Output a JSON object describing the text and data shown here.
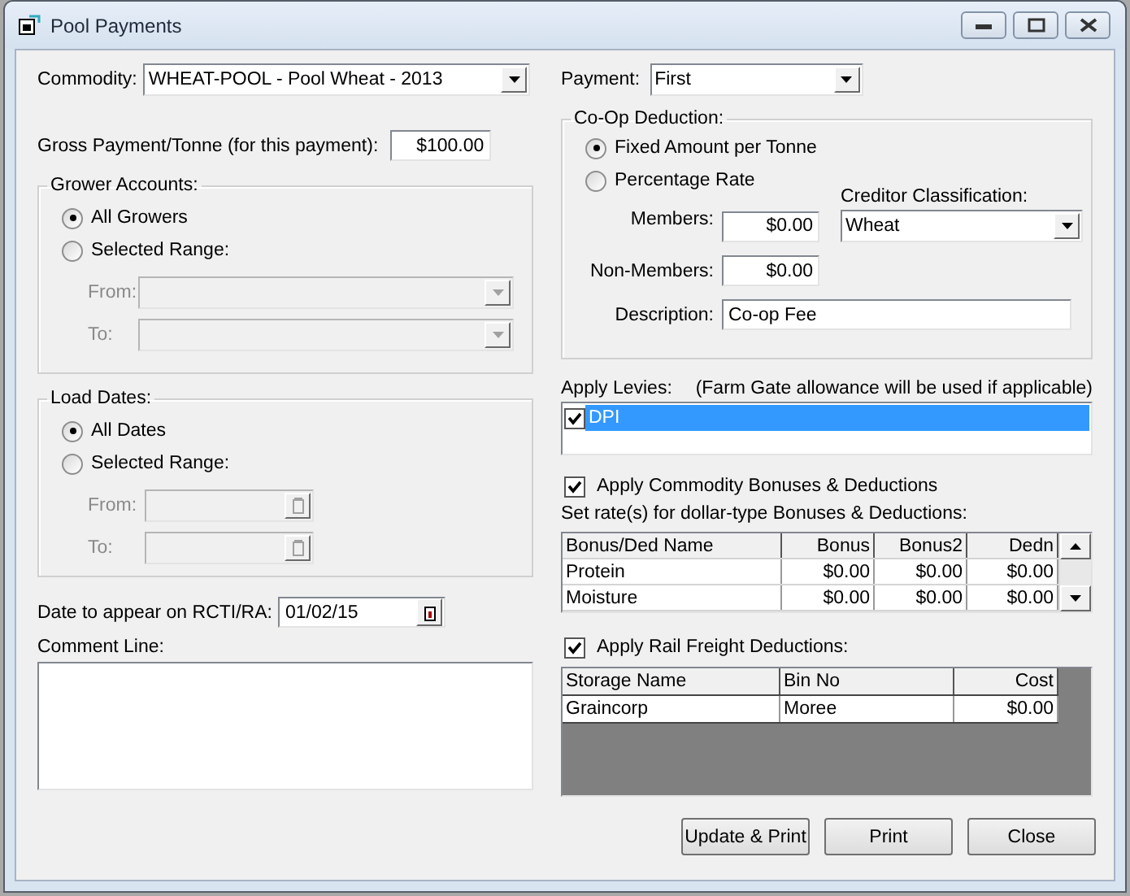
{
  "window": {
    "title": "Pool Payments"
  },
  "commodity": {
    "label": "Commodity:",
    "value": "WHEAT-POOL - Pool Wheat - 2013"
  },
  "payment": {
    "label": "Payment:",
    "value": "First"
  },
  "gross_payment": {
    "label": "Gross Payment/Tonne (for this payment):",
    "value": "$100.00"
  },
  "grower_accounts": {
    "title": "Grower Accounts:",
    "options": [
      {
        "label": "All Growers",
        "selected": true
      },
      {
        "label": "Selected Range:",
        "selected": false
      }
    ],
    "range": [
      {
        "label": "From:",
        "disabled": true
      },
      {
        "label": "To:",
        "disabled": true
      }
    ]
  },
  "load_dates": {
    "title": "Load Dates:",
    "options": [
      {
        "label": "All Dates",
        "selected": true
      },
      {
        "label": "Selected Range:",
        "selected": false
      }
    ],
    "range": [
      {
        "label": "From:",
        "disabled": true
      },
      {
        "label": "To:",
        "disabled": true
      }
    ]
  },
  "rcti_date": {
    "label": "Date to appear on RCTI/RA:",
    "value": "01/02/15"
  },
  "comment": {
    "label": "Comment Line:"
  },
  "coop_deduction": {
    "title": "Co-Op Deduction:",
    "options": [
      {
        "label": "Fixed Amount per Tonne",
        "selected": true
      },
      {
        "label": "Percentage Rate",
        "selected": false
      }
    ],
    "members": {
      "label": "Members:",
      "value": "$0.00"
    },
    "non_members": {
      "label": "Non-Members:",
      "value": "$0.00"
    },
    "description": {
      "label": "Description:",
      "value": "Co-op Fee"
    },
    "creditor_classification": {
      "label": "Creditor Classification:",
      "value": "Wheat"
    }
  },
  "levies": {
    "label": "Apply Levies:",
    "note": "(Farm Gate allowance will be used if applicable)",
    "items": [
      {
        "label": "DPI",
        "checked": true,
        "selected": true
      }
    ]
  },
  "bonuses": {
    "label": "Apply Commodity Bonuses & Deductions",
    "checked": true
  },
  "rates_label": "Set rate(s) for dollar-type Bonuses & Deductions:",
  "bonus_table": {
    "columns": [
      "Bonus/Ded Name",
      "Bonus",
      "Bonus2",
      "Dedn"
    ],
    "rows": [
      [
        "Protein",
        "$0.00",
        "$0.00",
        "$0.00"
      ],
      [
        "Moisture",
        "$0.00",
        "$0.00",
        "$0.00"
      ]
    ]
  },
  "rail_freight": {
    "label": "Apply Rail Freight Deductions:",
    "checked": true
  },
  "freight_table": {
    "columns": [
      "Storage Name",
      "Bin No",
      "Cost"
    ],
    "rows": [
      [
        "Graincorp",
        "Moree",
        "$0.00"
      ]
    ]
  },
  "buttons": [
    "Update & Print",
    "Print",
    "Close"
  ]
}
